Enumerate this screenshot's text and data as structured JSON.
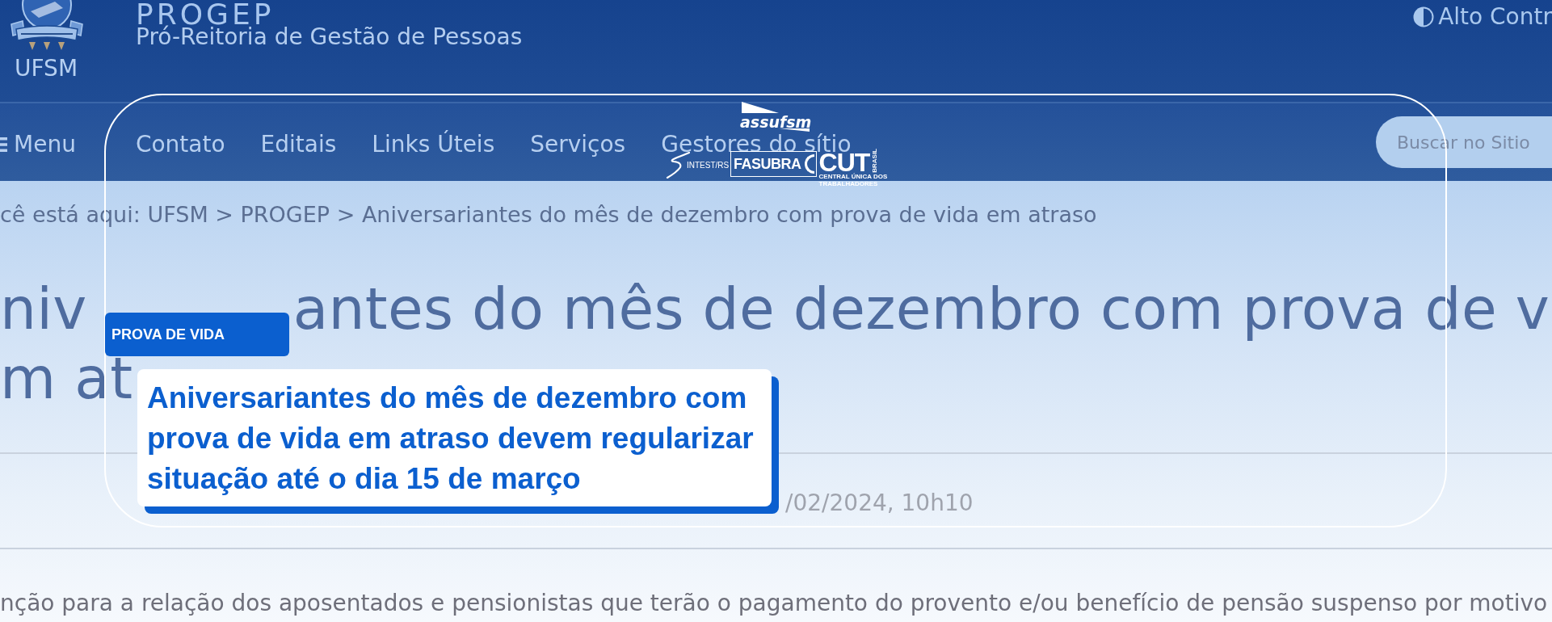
{
  "header": {
    "crest_caption": "UFSM",
    "site_title": "PROGEP",
    "subtitle": "Pró-Reitoria de Gestão de Pessoas",
    "contrast_toggle": "Alto Contr"
  },
  "nav": {
    "menu": "Menu",
    "items": [
      "Contato",
      "Editais",
      "Links Úteis",
      "Serviços",
      "Gestores do sítio"
    ],
    "search": {
      "placeholder": "Buscar no Sitio"
    }
  },
  "breadcrumb": {
    "prefix": "cê está aqui:",
    "links": [
      "UFSM",
      "PROGEP"
    ],
    "separator": ">",
    "current": "Aniversariantes do mês de dezembro com prova de vida em atraso"
  },
  "article": {
    "title_lines": [
      [
        "niv",
        "antes do mês de dezembro com prova de v"
      ],
      [
        "m at"
      ]
    ],
    "date": "/02/2024, 10h10",
    "body": "nção para a relação dos aposentados e pensionistas que terão o pagamento do provento e/ou benefício de pensão suspenso por motivo"
  },
  "overlay": {
    "logos": [
      {
        "kind": "flag",
        "text": "assufsm"
      },
      {
        "kind": "swoosh",
        "text": "INTEST/RS"
      },
      {
        "kind": "boxed",
        "text": "FASUBRA"
      },
      {
        "kind": "block",
        "text": "CUT",
        "side": "BRASIL",
        "caption": "CENTRAL ÚNICA DOS TRABALHADORES"
      }
    ],
    "tag": "PROVA DE VIDA",
    "headline": "Aniversariantes do mês de dezembro com prova de vida em atraso devem regularizar situação até o dia 15 de março"
  }
}
